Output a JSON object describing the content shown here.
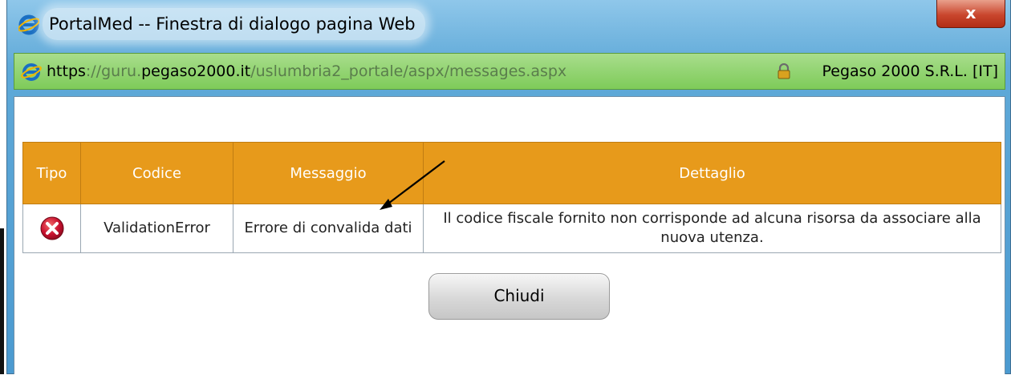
{
  "window": {
    "title": "PortalMed -- Finestra di dialogo pagina Web",
    "close_glyph": "x"
  },
  "address": {
    "scheme": "https",
    "sep": "://",
    "subdomain": "guru.",
    "domain": "pegaso2000.it",
    "path": "/uslumbria2_portale/aspx/messages.aspx",
    "certificate": "Pegaso 2000 S.R.L. [IT]"
  },
  "table": {
    "headers": [
      "Tipo",
      "Codice",
      "Messaggio",
      "Dettaglio"
    ],
    "rows": [
      {
        "type_icon": "error-icon",
        "code": "ValidationError",
        "message": "Errore di convalida dati",
        "detail": "Il codice fiscale fornito non corrisponde ad alcuna risorsa da associare alla nuova utenza."
      }
    ]
  },
  "buttons": {
    "close_label": "Chiudi"
  },
  "colors": {
    "header_orange": "#e79a1b",
    "addressbar_green": "#7ecb59",
    "titlebar_blue": "#5fa9d8",
    "error_red": "#c8102e"
  }
}
